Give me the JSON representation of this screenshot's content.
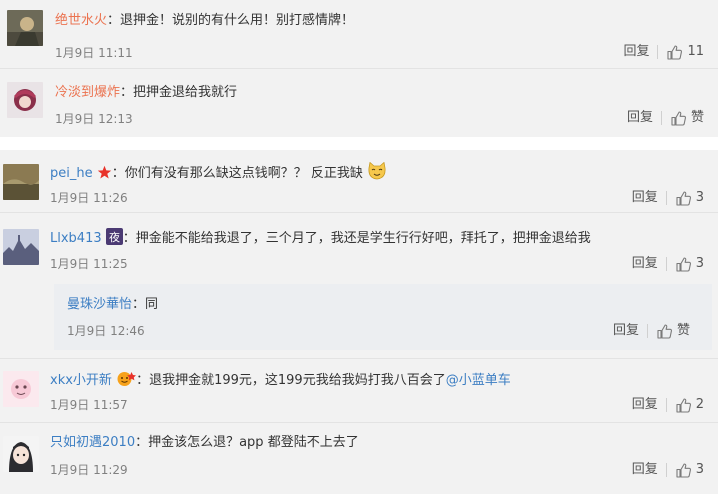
{
  "reply_label": "回复",
  "like_label": "赞",
  "comments": [
    {
      "user": "绝世水火",
      "text": "：退押金！说别的有什么用！别打感情牌！",
      "time": "1月9日 11:11",
      "likes": "11"
    },
    {
      "user": "冷淡到爆炸",
      "text": "：把押金退给我就行",
      "time": "1月9日 12:13",
      "likes": "赞"
    },
    {
      "user": "pei_he",
      "text": "：你们有没有那么缺这点钱啊？？ 反正我缺",
      "time": "1月9日 11:26",
      "likes": "3"
    },
    {
      "user": "Llxb413",
      "text": "：押金能不能给我退了，三个月了，我还是学生行行好吧，拜托了，把押金退给我",
      "time": "1月9日 11:25",
      "likes": "3"
    },
    {
      "user": "曼珠沙華怡",
      "text": "：同",
      "time": "1月9日 12:46",
      "likes": "赞"
    },
    {
      "user": "xkx小开新",
      "text": "：退我押金就199元，这199元我给我妈打我八百会了",
      "mention": "@小蓝单车",
      "time": "1月9日 11:57",
      "likes": "2"
    },
    {
      "user": "只如初遇2010",
      "text": "：押金该怎么退？app 都登陆不上去了",
      "time": "1月9日 11:29",
      "likes": "3"
    }
  ],
  "colors": {
    "username": "#eb7350",
    "link": "#3c7ec3",
    "card": "#f2f2f2",
    "subcard": "#eceef1"
  },
  "icons": [
    "thumb-up-icon",
    "star-badge-icon",
    "night-badge-icon",
    "cat-emoji-icon",
    "vip-badge-icon"
  ]
}
